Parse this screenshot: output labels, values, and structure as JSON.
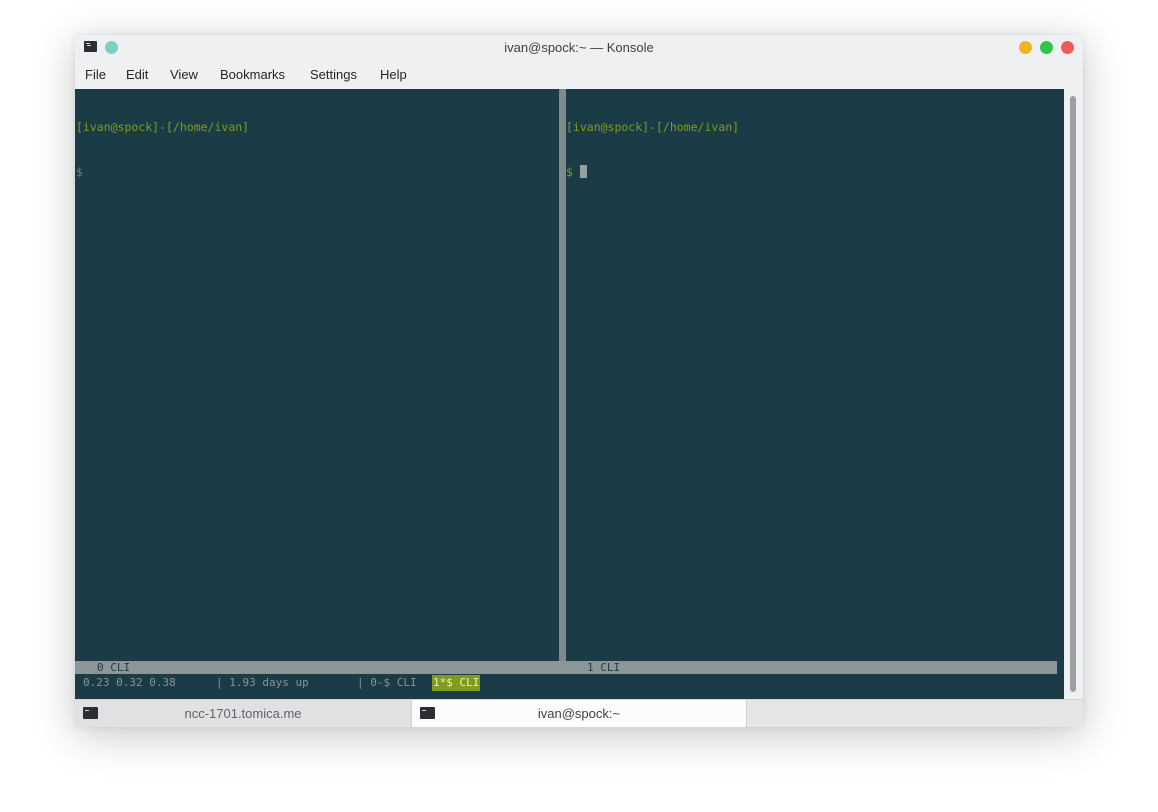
{
  "window": {
    "title": "ivan@spock:~ — Konsole"
  },
  "menubar": {
    "items": [
      "File",
      "Edit",
      "View",
      "Bookmarks",
      "Settings",
      "Help"
    ]
  },
  "panes": [
    {
      "prompt": "[ivan@spock]-[/home/ivan]",
      "dollar": "$",
      "label": "0 CLI"
    },
    {
      "prompt": "[ivan@spock]-[/home/ivan]",
      "dollar": "$",
      "label": "1 CLI"
    }
  ],
  "tmux_status": {
    "load": "0.23 0.32 0.38",
    "uptime": "| 1.93 days up",
    "window0": "| 0-$ CLI",
    "window1_active": "1*$ CLI"
  },
  "tabs": [
    {
      "label": "ncc-1701.tomica.me",
      "icon": "terminal-icon"
    },
    {
      "label": "ivan@spock:~",
      "icon": "terminal-icon"
    }
  ],
  "colors": {
    "terminal_bg": "#1b3b47",
    "prompt_green": "#7f9d1a",
    "close": "#f05a5a",
    "minimize": "#f2b41c",
    "maximize": "#2fc64b"
  }
}
